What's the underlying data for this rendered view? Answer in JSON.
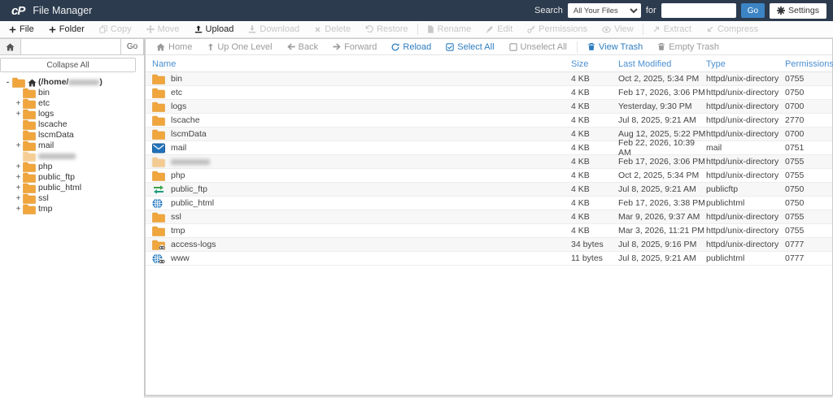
{
  "header": {
    "logo_text": "cP",
    "app_title": "File Manager",
    "search_label": "Search",
    "search_scope_selected": "All Your Files",
    "for_label": "for",
    "search_value": "",
    "go_label": "Go",
    "settings_label": "Settings"
  },
  "toolbar": {
    "items": [
      {
        "label": "File",
        "icon": "plus-icon",
        "enabled": true
      },
      {
        "label": "Folder",
        "icon": "plus-icon",
        "enabled": true
      },
      {
        "label": "Copy",
        "icon": "copy-icon",
        "enabled": false
      },
      {
        "label": "Move",
        "icon": "move-icon",
        "enabled": false
      },
      {
        "label": "Upload",
        "icon": "upload-icon",
        "enabled": true
      },
      {
        "label": "Download",
        "icon": "download-icon",
        "enabled": false
      },
      {
        "label": "Delete",
        "icon": "delete-icon",
        "enabled": false
      },
      {
        "label": "Restore",
        "icon": "restore-icon",
        "enabled": false
      },
      {
        "divider": true
      },
      {
        "label": "Rename",
        "icon": "rename-icon",
        "enabled": false
      },
      {
        "label": "Edit",
        "icon": "edit-icon",
        "enabled": false
      },
      {
        "label": "Permissions",
        "icon": "key-icon",
        "enabled": false
      },
      {
        "label": "View",
        "icon": "eye-icon",
        "enabled": false
      },
      {
        "divider": true
      },
      {
        "label": "Extract",
        "icon": "extract-icon",
        "enabled": false
      },
      {
        "label": "Compress",
        "icon": "compress-icon",
        "enabled": false
      }
    ]
  },
  "sidebar": {
    "path_value": "",
    "go_label": "Go",
    "collapse_all_label": "Collapse All",
    "tree": [
      {
        "label": "(/home/",
        "suffix": ")",
        "redacted": true,
        "toggle": "-",
        "icon": "folder",
        "home": true,
        "level": 0
      },
      {
        "label": "bin",
        "toggle": "",
        "icon": "folder",
        "level": 1
      },
      {
        "label": "etc",
        "toggle": "+",
        "icon": "folder",
        "level": 1
      },
      {
        "label": "logs",
        "toggle": "+",
        "icon": "folder",
        "level": 1
      },
      {
        "label": "lscache",
        "toggle": "",
        "icon": "folder",
        "level": 1
      },
      {
        "label": "lscmData",
        "toggle": "",
        "icon": "folder",
        "level": 1
      },
      {
        "label": "mail",
        "toggle": "+",
        "icon": "folder",
        "level": 1
      },
      {
        "label": "",
        "redacted": true,
        "toggle": "",
        "icon": "folder",
        "level": 1,
        "dim": true
      },
      {
        "label": "php",
        "toggle": "+",
        "icon": "folder",
        "level": 1
      },
      {
        "label": "public_ftp",
        "toggle": "+",
        "icon": "folder",
        "level": 1
      },
      {
        "label": "public_html",
        "toggle": "+",
        "icon": "folder",
        "level": 1
      },
      {
        "label": "ssl",
        "toggle": "+",
        "icon": "folder",
        "level": 1
      },
      {
        "label": "tmp",
        "toggle": "+",
        "icon": "folder",
        "level": 1
      }
    ]
  },
  "nav": {
    "items": [
      {
        "label": "Home",
        "icon": "home-icon",
        "style": "gray"
      },
      {
        "label": "Up One Level",
        "icon": "up-one-level-icon",
        "style": "gray"
      },
      {
        "label": "Back",
        "icon": "back-arrow-icon",
        "style": "gray"
      },
      {
        "label": "Forward",
        "icon": "forward-arrow-icon",
        "style": "gray"
      },
      {
        "label": "Reload",
        "icon": "reload-icon",
        "style": "blue"
      },
      {
        "label": "Select All",
        "icon": "select-all-icon",
        "style": "blue"
      },
      {
        "label": "Unselect All",
        "icon": "unselect-all-icon",
        "style": "gray"
      },
      {
        "divider": true
      },
      {
        "label": "View Trash",
        "icon": "trash-icon",
        "style": "blue"
      },
      {
        "label": "Empty Trash",
        "icon": "trash-icon",
        "style": "gray"
      }
    ]
  },
  "table": {
    "columns": [
      "Name",
      "Size",
      "Last Modified",
      "Type",
      "Permissions"
    ],
    "rows": [
      {
        "name": "bin",
        "icon": "folder",
        "size": "4 KB",
        "modified": "Oct 2, 2025, 5:34 PM",
        "type": "httpd/unix-directory",
        "permissions": "0755"
      },
      {
        "name": "etc",
        "icon": "folder",
        "size": "4 KB",
        "modified": "Feb 17, 2026, 3:06 PM",
        "type": "httpd/unix-directory",
        "permissions": "0750"
      },
      {
        "name": "logs",
        "icon": "folder",
        "size": "4 KB",
        "modified": "Yesterday, 9:30 PM",
        "type": "httpd/unix-directory",
        "permissions": "0700"
      },
      {
        "name": "lscache",
        "icon": "folder",
        "size": "4 KB",
        "modified": "Jul 8, 2025, 9:21 AM",
        "type": "httpd/unix-directory",
        "permissions": "2770"
      },
      {
        "name": "lscmData",
        "icon": "folder",
        "size": "4 KB",
        "modified": "Aug 12, 2025, 5:22 PM",
        "type": "httpd/unix-directory",
        "permissions": "0700"
      },
      {
        "name": "mail",
        "icon": "mail",
        "size": "4 KB",
        "modified": "Feb 22, 2026, 10:39 AM",
        "type": "mail",
        "permissions": "0751"
      },
      {
        "name": "",
        "redacted": true,
        "icon": "folder",
        "dim": true,
        "size": "4 KB",
        "modified": "Feb 17, 2026, 3:06 PM",
        "type": "httpd/unix-directory",
        "permissions": "0755"
      },
      {
        "name": "php",
        "icon": "folder",
        "size": "4 KB",
        "modified": "Oct 2, 2025, 5:34 PM",
        "type": "httpd/unix-directory",
        "permissions": "0755"
      },
      {
        "name": "public_ftp",
        "icon": "transfer",
        "size": "4 KB",
        "modified": "Jul 8, 2025, 9:21 AM",
        "type": "publicftp",
        "permissions": "0750"
      },
      {
        "name": "public_html",
        "icon": "globe",
        "size": "4 KB",
        "modified": "Feb 17, 2026, 3:38 PM",
        "type": "publichtml",
        "permissions": "0750"
      },
      {
        "name": "ssl",
        "icon": "folder",
        "size": "4 KB",
        "modified": "Mar 9, 2026, 9:37 AM",
        "type": "httpd/unix-directory",
        "permissions": "0755"
      },
      {
        "name": "tmp",
        "icon": "folder",
        "size": "4 KB",
        "modified": "Mar 3, 2026, 11:21 PM",
        "type": "httpd/unix-directory",
        "permissions": "0755"
      },
      {
        "name": "access-logs",
        "icon": "folder-link",
        "size": "34 bytes",
        "modified": "Jul 8, 2025, 9:16 PM",
        "type": "httpd/unix-directory",
        "permissions": "0777"
      },
      {
        "name": "www",
        "icon": "globe-link",
        "size": "11 bytes",
        "modified": "Jul 8, 2025, 9:21 AM",
        "type": "publichtml",
        "permissions": "0777"
      }
    ]
  },
  "colors": {
    "header_bg": "#2c3b4e",
    "accent_blue": "#2e7dbf",
    "go_button_blue": "#3c84c4",
    "column_header_blue": "#4a90d2",
    "folder_orange": "#f0a63d"
  }
}
